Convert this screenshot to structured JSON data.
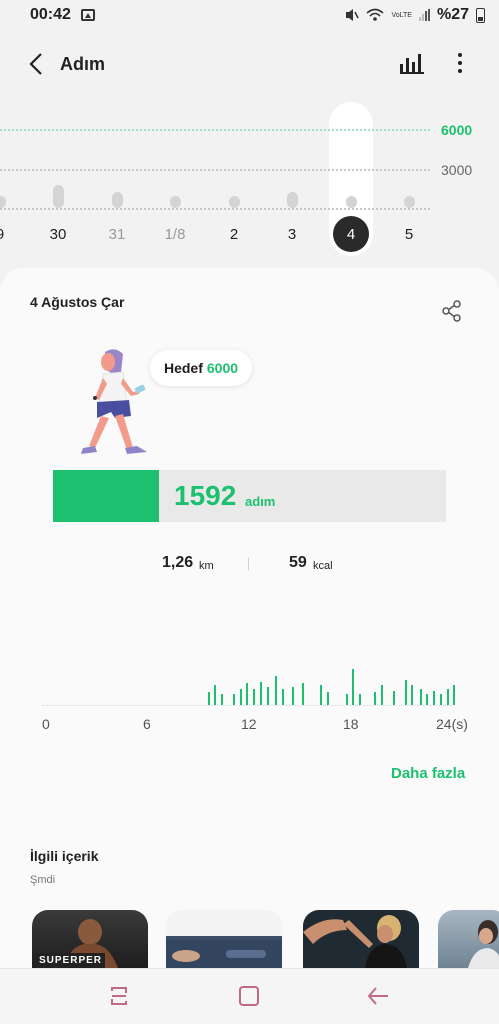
{
  "status_bar": {
    "time": "00:42",
    "network_label": "VoLTE",
    "battery_text": "%27"
  },
  "header": {
    "title": "Adım"
  },
  "week_chart": {
    "goal_label": "6000",
    "mid_label": "3000",
    "y_max": 6000,
    "days": [
      {
        "label": "9",
        "steps": 900,
        "future": false
      },
      {
        "label": "30",
        "steps": 1750,
        "future": false
      },
      {
        "label": "31",
        "steps": 1200,
        "future": false
      },
      {
        "label": "1/8",
        "steps": 420,
        "future": false
      },
      {
        "label": "2",
        "steps": 520,
        "future": false
      },
      {
        "label": "3",
        "steps": 1200,
        "future": false
      },
      {
        "label": "4",
        "steps": 590,
        "future": false,
        "selected": true
      },
      {
        "label": "5",
        "steps": 320,
        "future": false
      }
    ]
  },
  "day_detail": {
    "date": "4 Ağustos Çar",
    "goal_prefix": "Hedef",
    "goal_value": "6000",
    "steps": "1592",
    "steps_unit": "adım",
    "progress_fraction": 0.27,
    "distance": "1,26",
    "distance_unit": "km",
    "calories": "59",
    "calories_unit": "kcal"
  },
  "hourly_chart": {
    "x_labels": [
      "0",
      "6",
      "12",
      "18",
      "24(s)"
    ],
    "bars": [
      {
        "hour": 9.6,
        "value": 0.35
      },
      {
        "hour": 10.0,
        "value": 0.55
      },
      {
        "hour": 10.4,
        "value": 0.3
      },
      {
        "hour": 11.1,
        "value": 0.3
      },
      {
        "hour": 11.5,
        "value": 0.45
      },
      {
        "hour": 11.9,
        "value": 0.6
      },
      {
        "hour": 12.3,
        "value": 0.45
      },
      {
        "hour": 12.7,
        "value": 0.65
      },
      {
        "hour": 13.1,
        "value": 0.5
      },
      {
        "hour": 13.6,
        "value": 0.8
      },
      {
        "hour": 14.0,
        "value": 0.45
      },
      {
        "hour": 14.6,
        "value": 0.5
      },
      {
        "hour": 15.2,
        "value": 0.6
      },
      {
        "hour": 16.3,
        "value": 0.55
      },
      {
        "hour": 16.7,
        "value": 0.35
      },
      {
        "hour": 17.8,
        "value": 0.3
      },
      {
        "hour": 18.2,
        "value": 1.0
      },
      {
        "hour": 18.6,
        "value": 0.3
      },
      {
        "hour": 19.5,
        "value": 0.35
      },
      {
        "hour": 19.9,
        "value": 0.55
      },
      {
        "hour": 20.6,
        "value": 0.4
      },
      {
        "hour": 21.3,
        "value": 0.7
      },
      {
        "hour": 21.7,
        "value": 0.55
      },
      {
        "hour": 22.2,
        "value": 0.45
      },
      {
        "hour": 22.6,
        "value": 0.3
      },
      {
        "hour": 23.0,
        "value": 0.4
      },
      {
        "hour": 23.4,
        "value": 0.3
      },
      {
        "hour": 23.8,
        "value": 0.45
      },
      {
        "hour": 24.2,
        "value": 0.55
      }
    ]
  },
  "more_link": "Daha fazla",
  "related": {
    "title": "İlgili içerik",
    "subtitle": "Şmdi",
    "card_label": "SUPERPER"
  },
  "icons": {
    "back": "chevron-left-icon",
    "stats": "bar-chart-icon",
    "more": "more-vertical-icon",
    "share": "share-icon"
  },
  "colors": {
    "accent": "#1dc06f",
    "nav_icons": "#c06a86"
  }
}
